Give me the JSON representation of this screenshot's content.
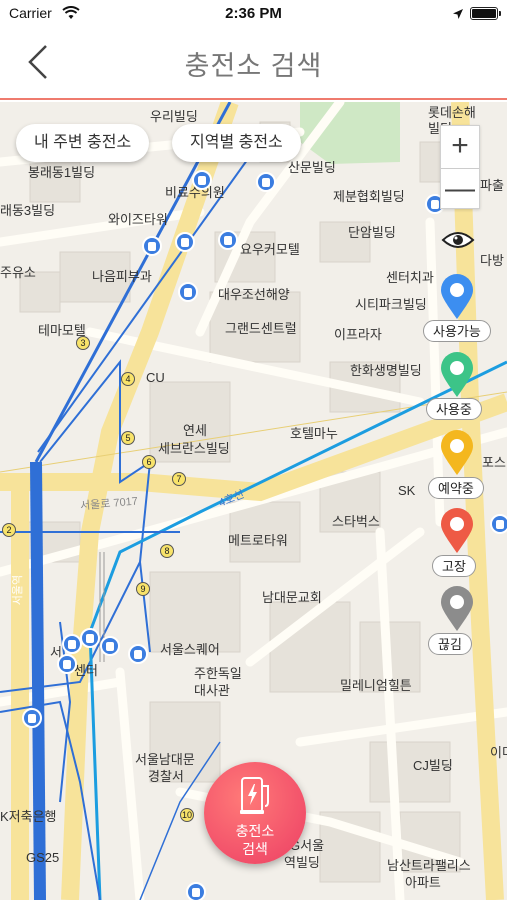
{
  "status_bar": {
    "carrier": "Carrier",
    "time": "2:36 PM"
  },
  "nav": {
    "title": "충전소 검색"
  },
  "search_chips": {
    "nearby": "내 주변 충전소",
    "regional": "지역별 충전소"
  },
  "zoom": {
    "plus": "+",
    "minus": "—"
  },
  "legend": [
    {
      "label": "사용가능",
      "color": "#3c8ef0"
    },
    {
      "label": "사용중",
      "color": "#3cc488"
    },
    {
      "label": "예약중",
      "color": "#f4b71e"
    },
    {
      "label": "고장",
      "color": "#ee5a45"
    },
    {
      "label": "끊김",
      "color": "#8c8c8c"
    }
  ],
  "fab": {
    "line1": "충전소",
    "line2": "검색"
  },
  "map_labels": {
    "l1": "우리빌딩",
    "l2": "봉래동1빌딩",
    "l3": "래동3빌딩",
    "l4": "와이즈타워",
    "l5": "비료수의원",
    "l6": "나음피부과",
    "l7": "주유소",
    "l8": "테마모텔",
    "l9": "CU",
    "l10": "연세",
    "l11": "세브란스빌딩",
    "l12": "요우커모텔",
    "l13": "대우조선해양",
    "l14": "그랜드센트럴",
    "l15": "이프라자",
    "l16": "호텔마누",
    "l17": "한화생명빌딩",
    "l18": "단암빌딩",
    "l19": "센터치과",
    "l20": "시티파크빌딩",
    "l21": "제분협회빌딩",
    "l22": "산문빌딩",
    "l23": "스타벅스",
    "l24": "메트로타워",
    "l25": "남대문교회",
    "l26": "서울스퀘어",
    "l27": "주한독일",
    "l28": "대사관",
    "l29": "밀레니엄힐튼",
    "l30": "서울남대문",
    "l31": "경찰서",
    "l32": "CJ빌딩",
    "l33": "K저축은행",
    "l34": "GS25",
    "l35": "남산트라팰리스",
    "l36": "아파트",
    "l37": "G서울",
    "l38": "역빌딩",
    "l39": "SK",
    "l40": "포스",
    "l41": "파출",
    "l42": "다방",
    "l43": "롯데손해",
    "l44": "빌딩",
    "l45": "서울로 7017",
    "l46": "4호선",
    "l47": "센터",
    "l48": "이더",
    "l49": "서울역",
    "l50": "서"
  }
}
